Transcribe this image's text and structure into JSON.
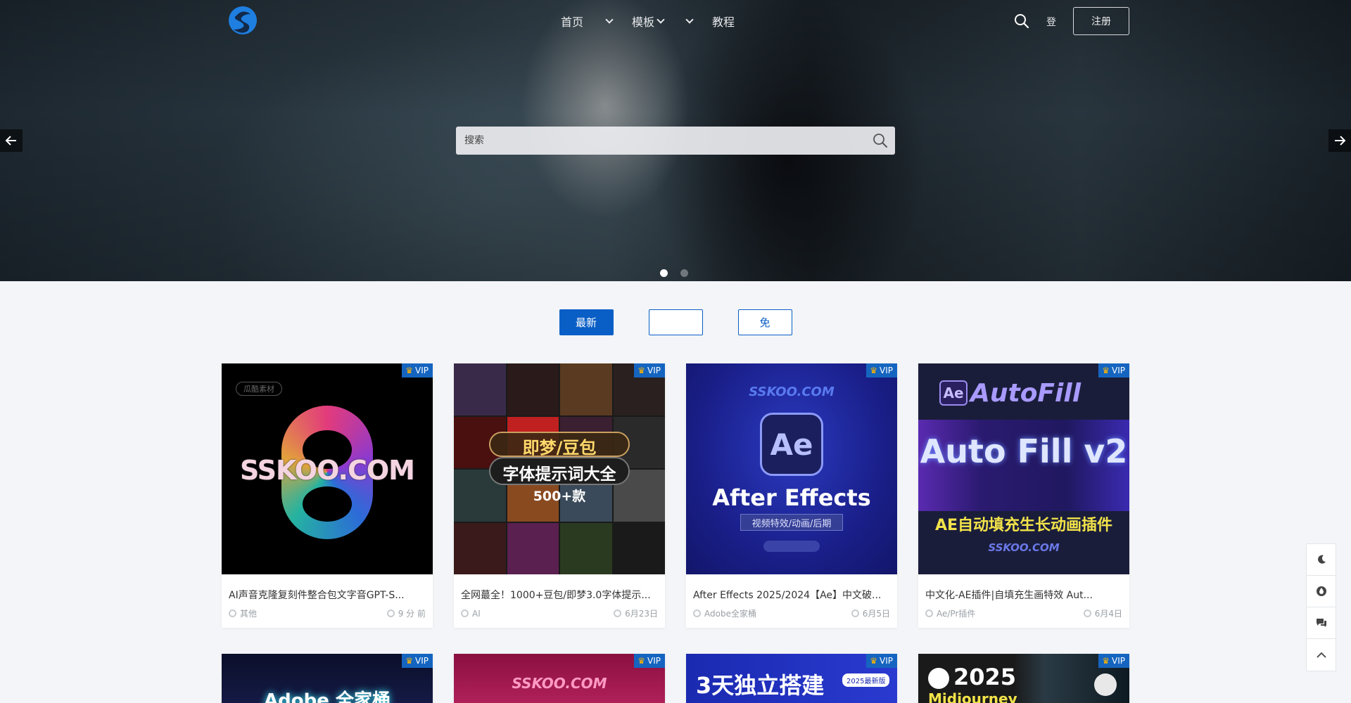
{
  "nav": {
    "items": [
      {
        "label": "首页",
        "dropdown": false
      },
      {
        "label": "",
        "dropdown": true
      },
      {
        "label": "模板",
        "dropdown": true
      },
      {
        "label": "",
        "dropdown": true
      },
      {
        "label": "教程",
        "dropdown": false
      }
    ],
    "login_label": "登",
    "register_label": "注册"
  },
  "hero": {
    "search_placeholder": "搜索",
    "slides_total": 2,
    "active_slide": 1
  },
  "filters": [
    {
      "label": "最新",
      "active": true
    },
    {
      "label": "",
      "active": false
    },
    {
      "label": "免",
      "active": false
    }
  ],
  "cards": [
    {
      "title": "AI声音克隆复刻件整合包文字音GPT-S...",
      "category": "其他",
      "time": "9 分 前",
      "badge": "VIP",
      "thumb_text": "SSKOO.COM",
      "thumb_label": "瓜酷素材"
    },
    {
      "title": "全网蕞全！1000+豆包/即梦3.0字体提示...",
      "category": "AI",
      "time": "6月23日",
      "badge": "VIP",
      "thumb_text": "即梦/豆包",
      "thumb_sub": "字体提示词大全",
      "thumb_count": "500+款"
    },
    {
      "title": "After Effects 2025/2024【Ae】中文破...",
      "category": "Adobe全家桶",
      "time": "6月5日",
      "badge": "VIP",
      "thumb_text": "After Effects",
      "thumb_logo": "Ae",
      "thumb_sub": "视频特效/动画/后期",
      "thumb_brand": "SSKOO.COM"
    },
    {
      "title": "中文化-AE插件|自填充生画特效 Aut...",
      "category": "Ae/Pr插件",
      "time": "6月4日",
      "badge": "VIP",
      "thumb_logo": "Ae",
      "thumb_text": "AutoFill",
      "thumb_big": "Auto Fill v2",
      "thumb_sub": "AE自动填充生长动画插件",
      "thumb_brand": "SSKOO.COM"
    }
  ],
  "cards_row2": [
    {
      "badge": "VIP",
      "thumb_text": "Adobe 全家桶"
    },
    {
      "badge": "VIP",
      "thumb_text": "SSKOO.COM"
    },
    {
      "badge": "VIP",
      "thumb_text": "3天独立搭建",
      "thumb_tag": "2025最新版"
    },
    {
      "badge": "VIP",
      "thumb_text": "2025",
      "thumb_sub": "Midjourney"
    }
  ],
  "colors": {
    "accent": "#0a5fc6",
    "vip": "#1565c0",
    "crown": "#ffb300"
  }
}
